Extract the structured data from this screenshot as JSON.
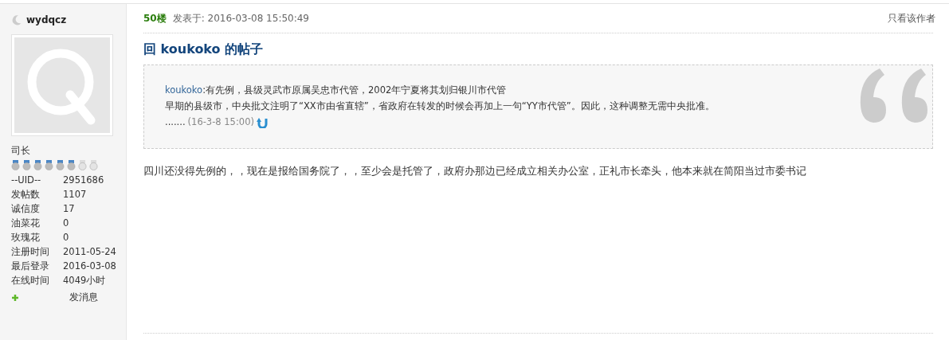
{
  "author": {
    "name": "wydqcz",
    "rank": "司长",
    "stars": 6,
    "stats": [
      {
        "label": "--UID--",
        "value": "2951686"
      },
      {
        "label": "发帖数",
        "value": "1107"
      },
      {
        "label": "诚信度",
        "value": "17"
      },
      {
        "label": "油菜花",
        "value": "0"
      },
      {
        "label": "玫瑰花",
        "value": "0"
      },
      {
        "label": "注册时间",
        "value": "2011-05-24"
      },
      {
        "label": "最后登录",
        "value": "2016-03-08"
      },
      {
        "label": "在线时间",
        "value": "4049小时"
      }
    ],
    "message_link": "发消息"
  },
  "post": {
    "floor": "50楼",
    "posted": "发表于: 2016-03-08 15:50:49",
    "author_only": "只看该作者",
    "title": "回 koukoko 的帖子",
    "quote": {
      "user": "koukoko",
      "line_1": ":有先例，县级灵武市原属吴忠市代管，2002年宁夏将其划归银川市代管",
      "line_2": "早期的县级市，中央批文注明了“XX市由省直辖”，省政府在转发的时候会再加上一句“YY市代管”。因此，这种调整无需中央批准。",
      "ellipsis": ".......",
      "time": "(16-3-8 15:00)"
    },
    "body": "四川还没得先例的，，现在是报给国务院了，，至少会是托管了，政府办那边已经成立相关办公室，正礼市长牵头，他本来就在简阳当过市委书记"
  }
}
